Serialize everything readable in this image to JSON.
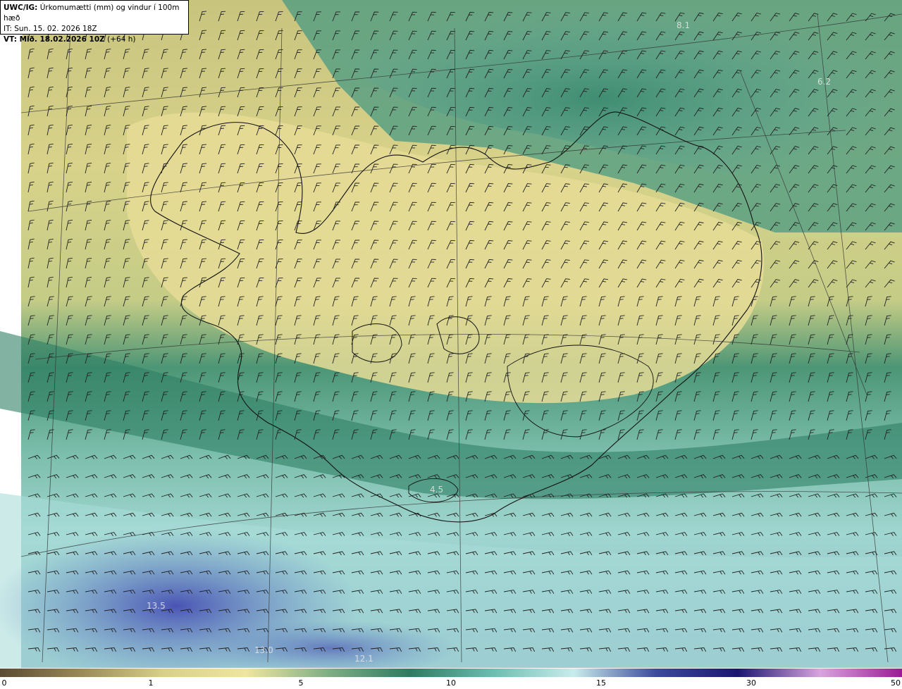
{
  "header": {
    "line1_bold": "UWC/IG:",
    "line1_text": " Úrkomumætti (mm) og vindur í 100m hæð",
    "line2": "IT: Sun. 15. 02. 2026 18Z",
    "line3_bold": "VT: Mið. 18.02.2026 10Z",
    "line3_text": " (+64 h)"
  },
  "map_labels": [
    "4.5",
    "13.5",
    "13.0",
    "12.1",
    "6.2",
    "8.1"
  ],
  "colorbar": {
    "ticks": [
      "0",
      "1",
      "5",
      "10",
      "15",
      "30",
      "50"
    ],
    "colors": [
      "#5a4a32",
      "#9a8a58",
      "#d8d08a",
      "#eee6a0",
      "#7fae84",
      "#2f7a62",
      "#6cbcb0",
      "#c8ecec",
      "#3c4a9c",
      "#1a1670",
      "#d9a4de",
      "#9a1a94"
    ]
  },
  "icons": [
    "wind-barb-icon"
  ],
  "palette": {
    "dry": "#ebe395",
    "moderate": "#3a8a70",
    "wet": "#5a6ac0"
  }
}
